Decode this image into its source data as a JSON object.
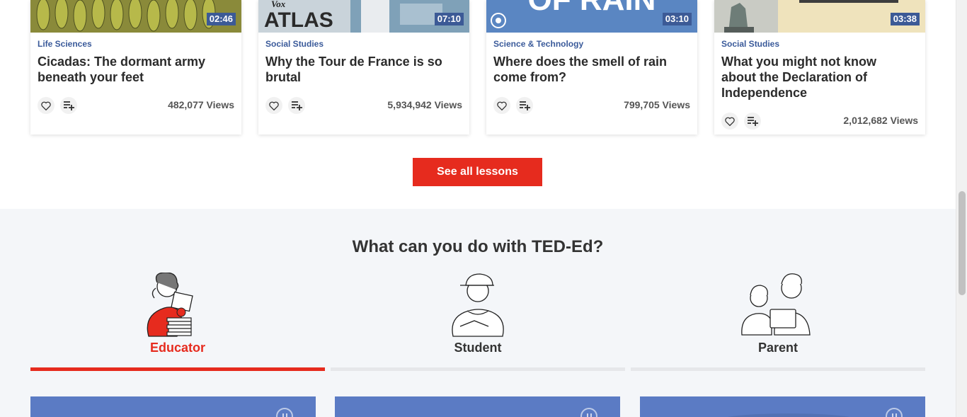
{
  "lessons": [
    {
      "duration": "02:46",
      "category": "Life Sciences",
      "title": "Cicadas: The dormant army beneath your feet",
      "views": "482,077 Views"
    },
    {
      "duration": "07:10",
      "category": "Social Studies",
      "title": "Why the Tour de France is so brutal",
      "views": "5,934,942 Views",
      "thumb_text": "ATLAS",
      "thumb_logo": "Vox"
    },
    {
      "duration": "03:10",
      "category": "Science & Technology",
      "title": "Where does the smell of rain come from?",
      "views": "799,705 Views",
      "thumb_text": "OF RAIN"
    },
    {
      "duration": "03:38",
      "category": "Social Studies",
      "title": "What you might not know about the Declaration of Independence",
      "views": "2,012,682 Views"
    }
  ],
  "icons": {
    "like": "heart-icon",
    "add": "playlist-add-icon",
    "pause": "pause-icon"
  },
  "see_all_label": "See all lessons",
  "section": {
    "title": "What can you do with TED-Ed?",
    "roles": [
      {
        "label": "Educator",
        "active": true
      },
      {
        "label": "Student",
        "active": false
      },
      {
        "label": "Parent",
        "active": false
      }
    ]
  },
  "colors": {
    "accent": "#e62b1e",
    "duration_badge": "#3c5a96",
    "category": "#3a5a9a",
    "tile": "#5b7bc4",
    "section_bg": "#f4f6f9"
  }
}
